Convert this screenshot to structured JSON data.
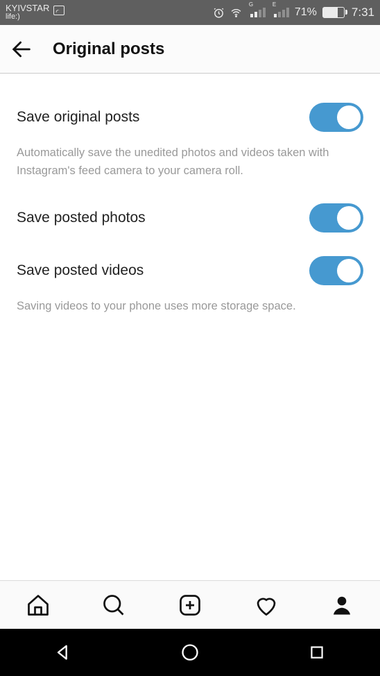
{
  "status": {
    "carrier_line1": "KYIVSTAR",
    "carrier_line2": "life:)",
    "signal1_label": "G",
    "signal2_label": "E",
    "battery_pct": "71%",
    "time": "7:31"
  },
  "header": {
    "title": "Original posts"
  },
  "settings": {
    "item1_label": "Save original posts",
    "item1_toggle": true,
    "item1_description": "Automatically save the unedited photos and videos taken with Instagram's feed camera to your camera roll.",
    "item2_label": "Save posted photos",
    "item2_toggle": true,
    "item3_label": "Save posted videos",
    "item3_toggle": true,
    "item3_description": "Saving videos to your phone uses more storage space."
  }
}
